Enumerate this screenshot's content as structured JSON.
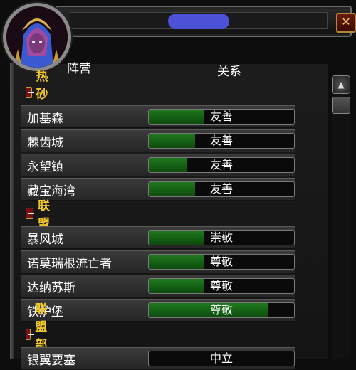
{
  "window": {
    "close_glyph": "✕"
  },
  "header": {
    "faction_col": "阵营",
    "relation_col": "关系"
  },
  "categories": [
    {
      "name": "热砂港",
      "rows": [
        {
          "name": "加基森",
          "standing": "友善",
          "fill": 0.38
        },
        {
          "name": "棘齿城",
          "standing": "友善",
          "fill": 0.32
        },
        {
          "name": "永望镇",
          "standing": "友善",
          "fill": 0.26
        },
        {
          "name": "藏宝海湾",
          "standing": "友善",
          "fill": 0.32
        }
      ]
    },
    {
      "name": "联盟",
      "rows": [
        {
          "name": "暴风城",
          "standing": "崇敬",
          "fill": 0.38
        },
        {
          "name": "诺莫瑞根流亡者",
          "standing": "尊敬",
          "fill": 0.38
        },
        {
          "name": "达纳苏斯",
          "standing": "尊敬",
          "fill": 0.38
        },
        {
          "name": "铁炉堡",
          "standing": "尊敬",
          "fill": 0.82
        }
      ]
    },
    {
      "name": "联盟部队",
      "rows": [
        {
          "name": "银翼要塞",
          "standing": "中立",
          "fill": 0.0
        }
      ]
    }
  ],
  "colors": {
    "category": "#f2c92a",
    "bar_fill": "#1e7a1e",
    "title_pill": "#4b52d8"
  },
  "icons": {
    "collapse": "minus-icon",
    "scroll_up": "scroll-up-arrow-icon"
  }
}
